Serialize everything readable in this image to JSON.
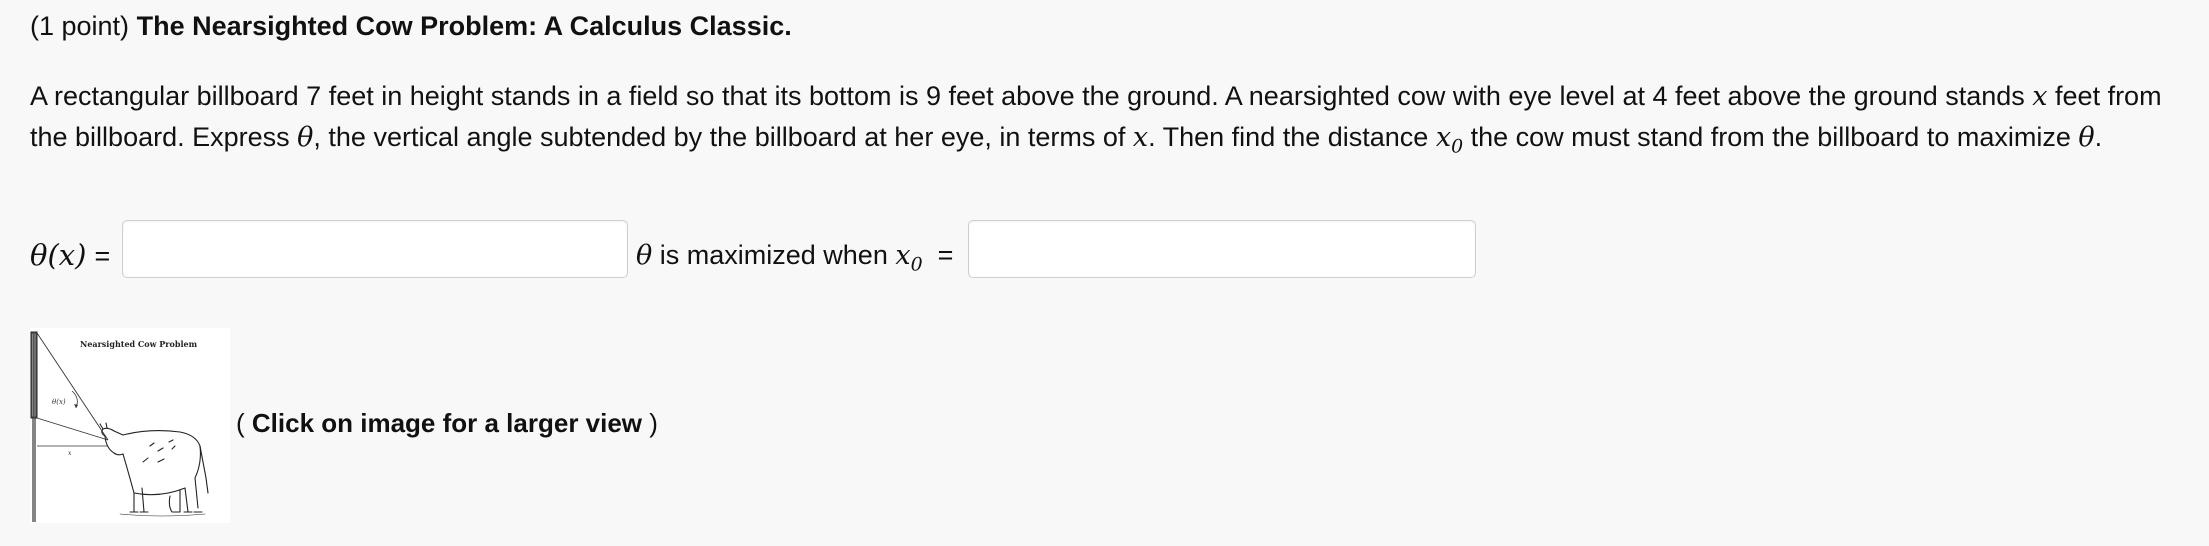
{
  "header": {
    "points": "(1 point)",
    "title": "The Nearsighted Cow Problem: A Calculus Classic."
  },
  "problem": {
    "p1": "A rectangular billboard 7 feet in height stands in a field so that its bottom is 9 feet above the ground. A nearsighted cow with eye level at 4 feet above the ground stands ",
    "var_x": "x",
    "p2": " feet from the billboard. Express ",
    "theta": "θ",
    "p3": ", the vertical angle subtended by the billboard at her eye, in terms of ",
    "p4": ". Then find the distance ",
    "x0_base": "x",
    "x0_sub": "0",
    "p5": " the cow must stand from the billboard to maximize ",
    "p6": "."
  },
  "answers": {
    "theta_of_x": "θ(x)",
    "equals": "=",
    "theta_input_value": "",
    "maximized_text": " is maximized when ",
    "x0_input_value": ""
  },
  "figure": {
    "title": "Nearsighted Cow Problem",
    "angle_label": "θ(x)",
    "x_label": "x",
    "note_open": "( ",
    "note_text": "Click on image for a larger view",
    "note_close": " )"
  }
}
